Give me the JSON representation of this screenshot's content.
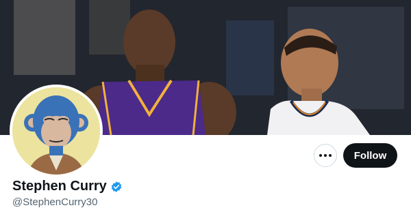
{
  "profile": {
    "display_name": "Stephen Curry",
    "handle": "@StephenCurry30",
    "verified": true
  },
  "actions": {
    "follow_label": "Follow",
    "more_icon": "more-horizontal-icon"
  },
  "banner": {
    "description": "photo",
    "colors": {
      "purple_jersey": "#4b2a8a",
      "jersey_trim": "#f2b13b",
      "white_jersey": "#f1f1f4",
      "navy_trim": "#1d2b4d"
    }
  },
  "avatar": {
    "description": "cartoon ape avatar",
    "background_color": "#ece39e"
  },
  "colors": {
    "follow_bg": "#0f1419",
    "follow_text": "#ffffff",
    "verified_blue": "#1d9bf0",
    "handle_gray": "#536471"
  }
}
